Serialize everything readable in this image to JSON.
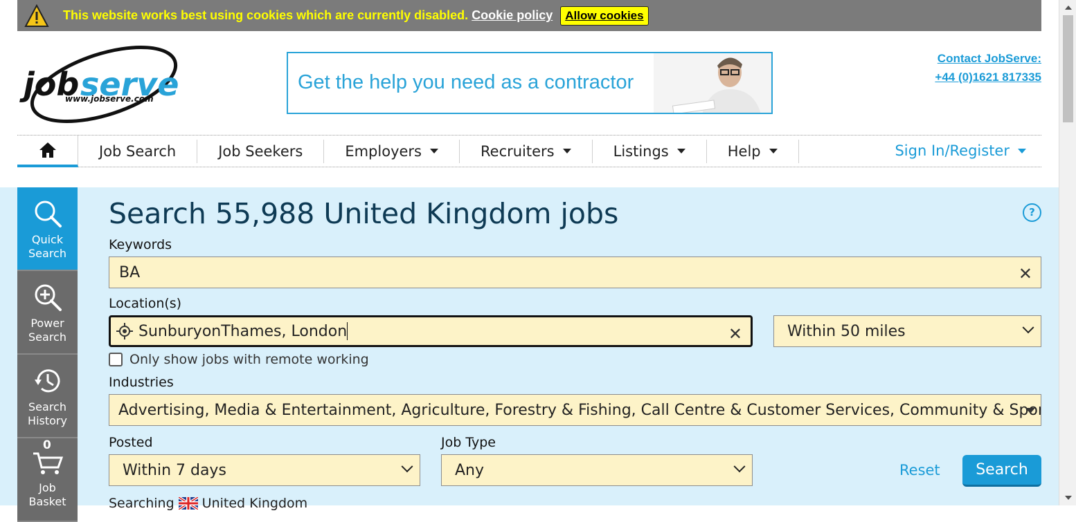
{
  "cookie_bar": {
    "message": "This website works best using cookies which are currently disabled.",
    "policy_link": "Cookie policy",
    "allow_button": "Allow cookies"
  },
  "header": {
    "logo_text": "jobserve",
    "logo_url_text": "www.jobserve.com",
    "banner_text": "Get the help you need as a contractor",
    "contact_label": "Contact JobServe:",
    "contact_phone": "+44 (0)1621 817335"
  },
  "nav": {
    "items": [
      {
        "label": "Job Search",
        "has_menu": false
      },
      {
        "label": "Job Seekers",
        "has_menu": false
      },
      {
        "label": "Employers",
        "has_menu": true
      },
      {
        "label": "Recruiters",
        "has_menu": true
      },
      {
        "label": "Listings",
        "has_menu": true
      },
      {
        "label": "Help",
        "has_menu": true
      }
    ],
    "signin": "Sign In/Register"
  },
  "sidebar": {
    "items": [
      {
        "label_line1": "Quick",
        "label_line2": "Search",
        "icon": "magnifier-icon",
        "active": true
      },
      {
        "label_line1": "Power",
        "label_line2": "Search",
        "icon": "zoom-plus-icon",
        "active": false
      },
      {
        "label_line1": "Search",
        "label_line2": "History",
        "icon": "history-icon",
        "active": false
      },
      {
        "label_line1": "Job",
        "label_line2": "Basket",
        "icon": "basket-icon",
        "active": false,
        "count": "0"
      }
    ]
  },
  "search": {
    "heading": "Search 55,988 United Kingdom jobs",
    "help": "?",
    "keywords_label": "Keywords",
    "keywords_value": "BA",
    "location_label": "Location(s)",
    "location_value": "SunburyonThames, London",
    "radius_value": "Within 50 miles",
    "remote_label": "Only show jobs with remote working",
    "industries_label": "Industries",
    "industries_value": "Advertising, Media & Entertainment, Agriculture, Forestry & Fishing, Call Centre & Customer Services, Community & Sport, …",
    "posted_label": "Posted",
    "posted_value": "Within 7 days",
    "jobtype_label": "Job Type",
    "jobtype_value": "Any",
    "reset_label": "Reset",
    "search_button": "Search",
    "searching_prefix": "Searching",
    "searching_country": "United Kingdom"
  },
  "colors": {
    "accent": "#1a9bd7",
    "panel_bg": "#d9f0fb",
    "field_bg": "#fdf3c8",
    "cookie_bg": "#7b7b7b",
    "cookie_text": "#ffff00",
    "sidebar_bg": "#6b6b6b"
  }
}
